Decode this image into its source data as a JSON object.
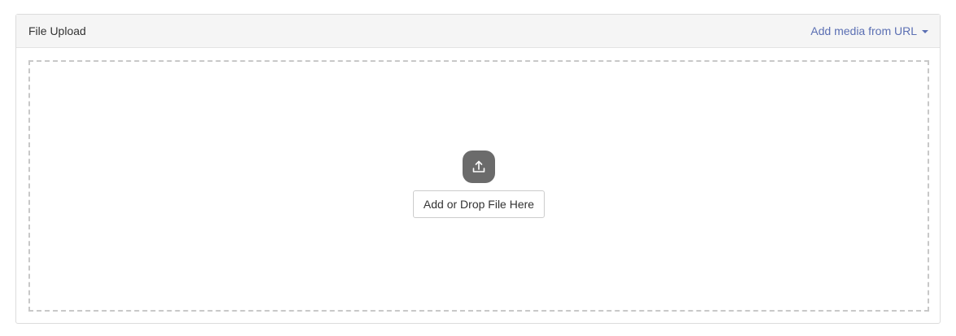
{
  "header": {
    "title": "File Upload",
    "url_link_label": "Add media from URL"
  },
  "dropzone": {
    "button_label": "Add or Drop File Here",
    "icon": "upload-icon"
  },
  "colors": {
    "link": "#5b6fb3",
    "icon_bg": "#6b6b6b",
    "header_bg": "#f5f5f5",
    "dashed_border": "#c8c8c8"
  }
}
